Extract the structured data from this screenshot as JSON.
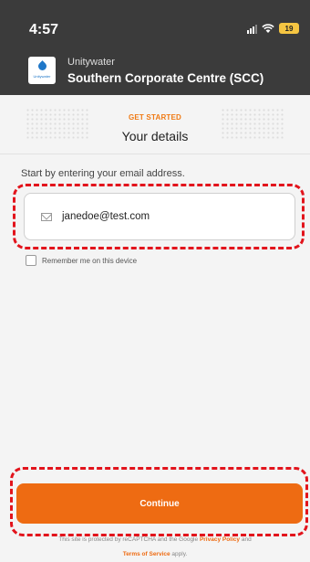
{
  "status_bar": {
    "time": "4:57",
    "battery": "19"
  },
  "header": {
    "org_name": "Unitywater",
    "site_name": "Southern Corporate Centre (SCC)",
    "logo_text": "Unitywater"
  },
  "intro": {
    "eyebrow": "GET STARTED",
    "title": "Your details"
  },
  "form": {
    "prompt": "Start by entering your email address.",
    "email_value": "janedoe@test.com",
    "remember_label": "Remember me on this device",
    "remember_checked": false
  },
  "actions": {
    "continue_label": "Continue"
  },
  "legal": {
    "text_start": "This site is protected by reCAPTCHA and the Google",
    "privacy_link": "Privacy Policy",
    "text_and": "and",
    "terms_link": "Terms of Service",
    "text_end": "apply."
  },
  "colors": {
    "accent": "#ee6b12",
    "highlight": "#e2141c",
    "header_bg": "#3b3b3b"
  }
}
